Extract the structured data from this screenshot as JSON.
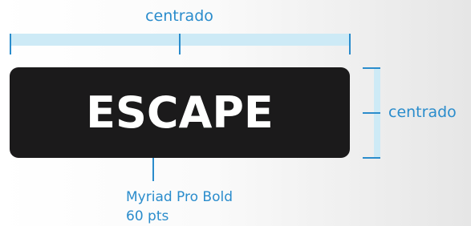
{
  "labels": {
    "horizontal_centering": "centrado",
    "vertical_centering": "centrado",
    "button_text": "ESCAPE",
    "font_name": "Myriad Pro Bold",
    "font_size": "60 pts"
  },
  "colors": {
    "accent": "#2a8ccc",
    "band": "#cdeaf6",
    "button": "#1b1a1b",
    "button_text": "#ffffff"
  }
}
